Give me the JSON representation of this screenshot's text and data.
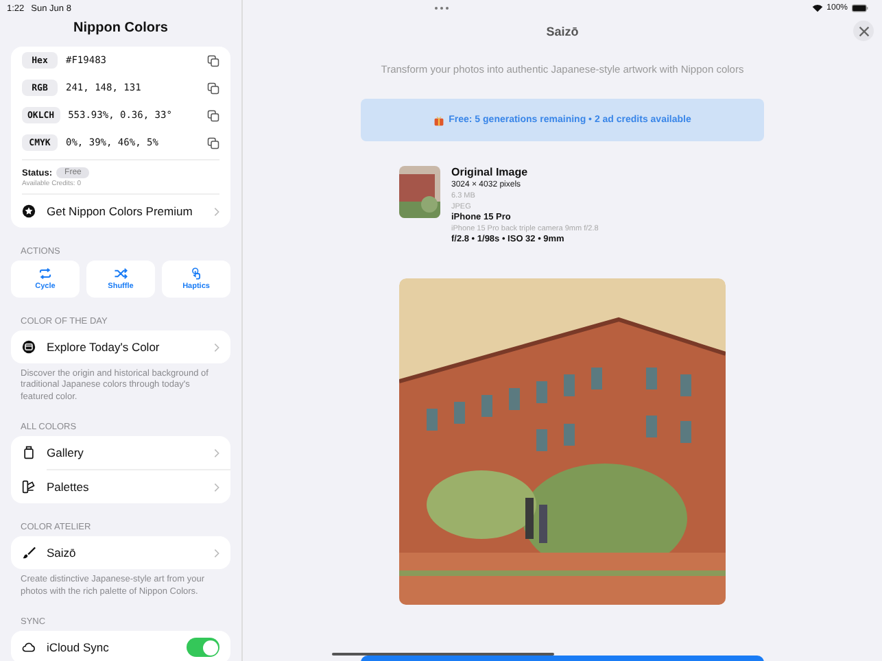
{
  "status_bar": {
    "time": "1:22",
    "date": "Sun Jun 8",
    "battery": "100%"
  },
  "sidebar": {
    "title": "Nippon Colors",
    "color_values": [
      {
        "label": "Hex",
        "value": "#F19483"
      },
      {
        "label": "RGB",
        "value": "241, 148, 131"
      },
      {
        "label": "OKLCH",
        "value": "553.93%, 0.36, 33°"
      },
      {
        "label": "CMYK",
        "value": "0%, 39%, 46%, 5%"
      }
    ],
    "status": {
      "label": "Status:",
      "value": "Free",
      "credits": "Available Credits: 0"
    },
    "premium": {
      "label": "Get Nippon Colors Premium"
    },
    "actions": {
      "header": "ACTIONS",
      "buttons": [
        {
          "label": "Cycle"
        },
        {
          "label": "Shuffle"
        },
        {
          "label": "Haptics"
        }
      ]
    },
    "sections": [
      {
        "header": "COLOR OF THE DAY",
        "items": [
          {
            "label": "Explore Today's Color",
            "kind": "link"
          }
        ],
        "footer": "Discover the origin and historical background of traditional Japanese colors through today's featured color."
      },
      {
        "header": "ALL COLORS",
        "items": [
          {
            "label": "Gallery",
            "kind": "link"
          },
          {
            "label": "Palettes",
            "kind": "link"
          }
        ]
      },
      {
        "header": "COLOR ATELIER",
        "items": [
          {
            "label": "Saizō",
            "kind": "link"
          }
        ],
        "footer": "Create distinctive Japanese-style art from your photos with the rich palette of Nippon Colors."
      },
      {
        "header": "SYNC",
        "items": [
          {
            "label": "iCloud Sync",
            "kind": "toggle",
            "on": true
          }
        ]
      }
    ]
  },
  "main": {
    "title": "Saizō",
    "subtitle": "Transform your photos into authentic Japanese-style artwork with Nippon colors",
    "banner": "Free: 5 generations remaining • 2 ad credits available",
    "original": {
      "lines": [
        {
          "text": "Original Image",
          "kind": "title"
        },
        {
          "text": "3024 × 4032 pixels",
          "kind": "plain"
        },
        {
          "text": "6.3 MB",
          "kind": "muted"
        },
        {
          "text": "JPEG",
          "kind": "muted"
        },
        {
          "text": "iPhone 15 Pro",
          "kind": "strong"
        },
        {
          "text": "iPhone 15 Pro back triple camera 9mm f/2.8",
          "kind": "muted"
        },
        {
          "text": "f/2.8 • 1/98s • ISO 32 • 9mm",
          "kind": "strong"
        }
      ]
    }
  }
}
